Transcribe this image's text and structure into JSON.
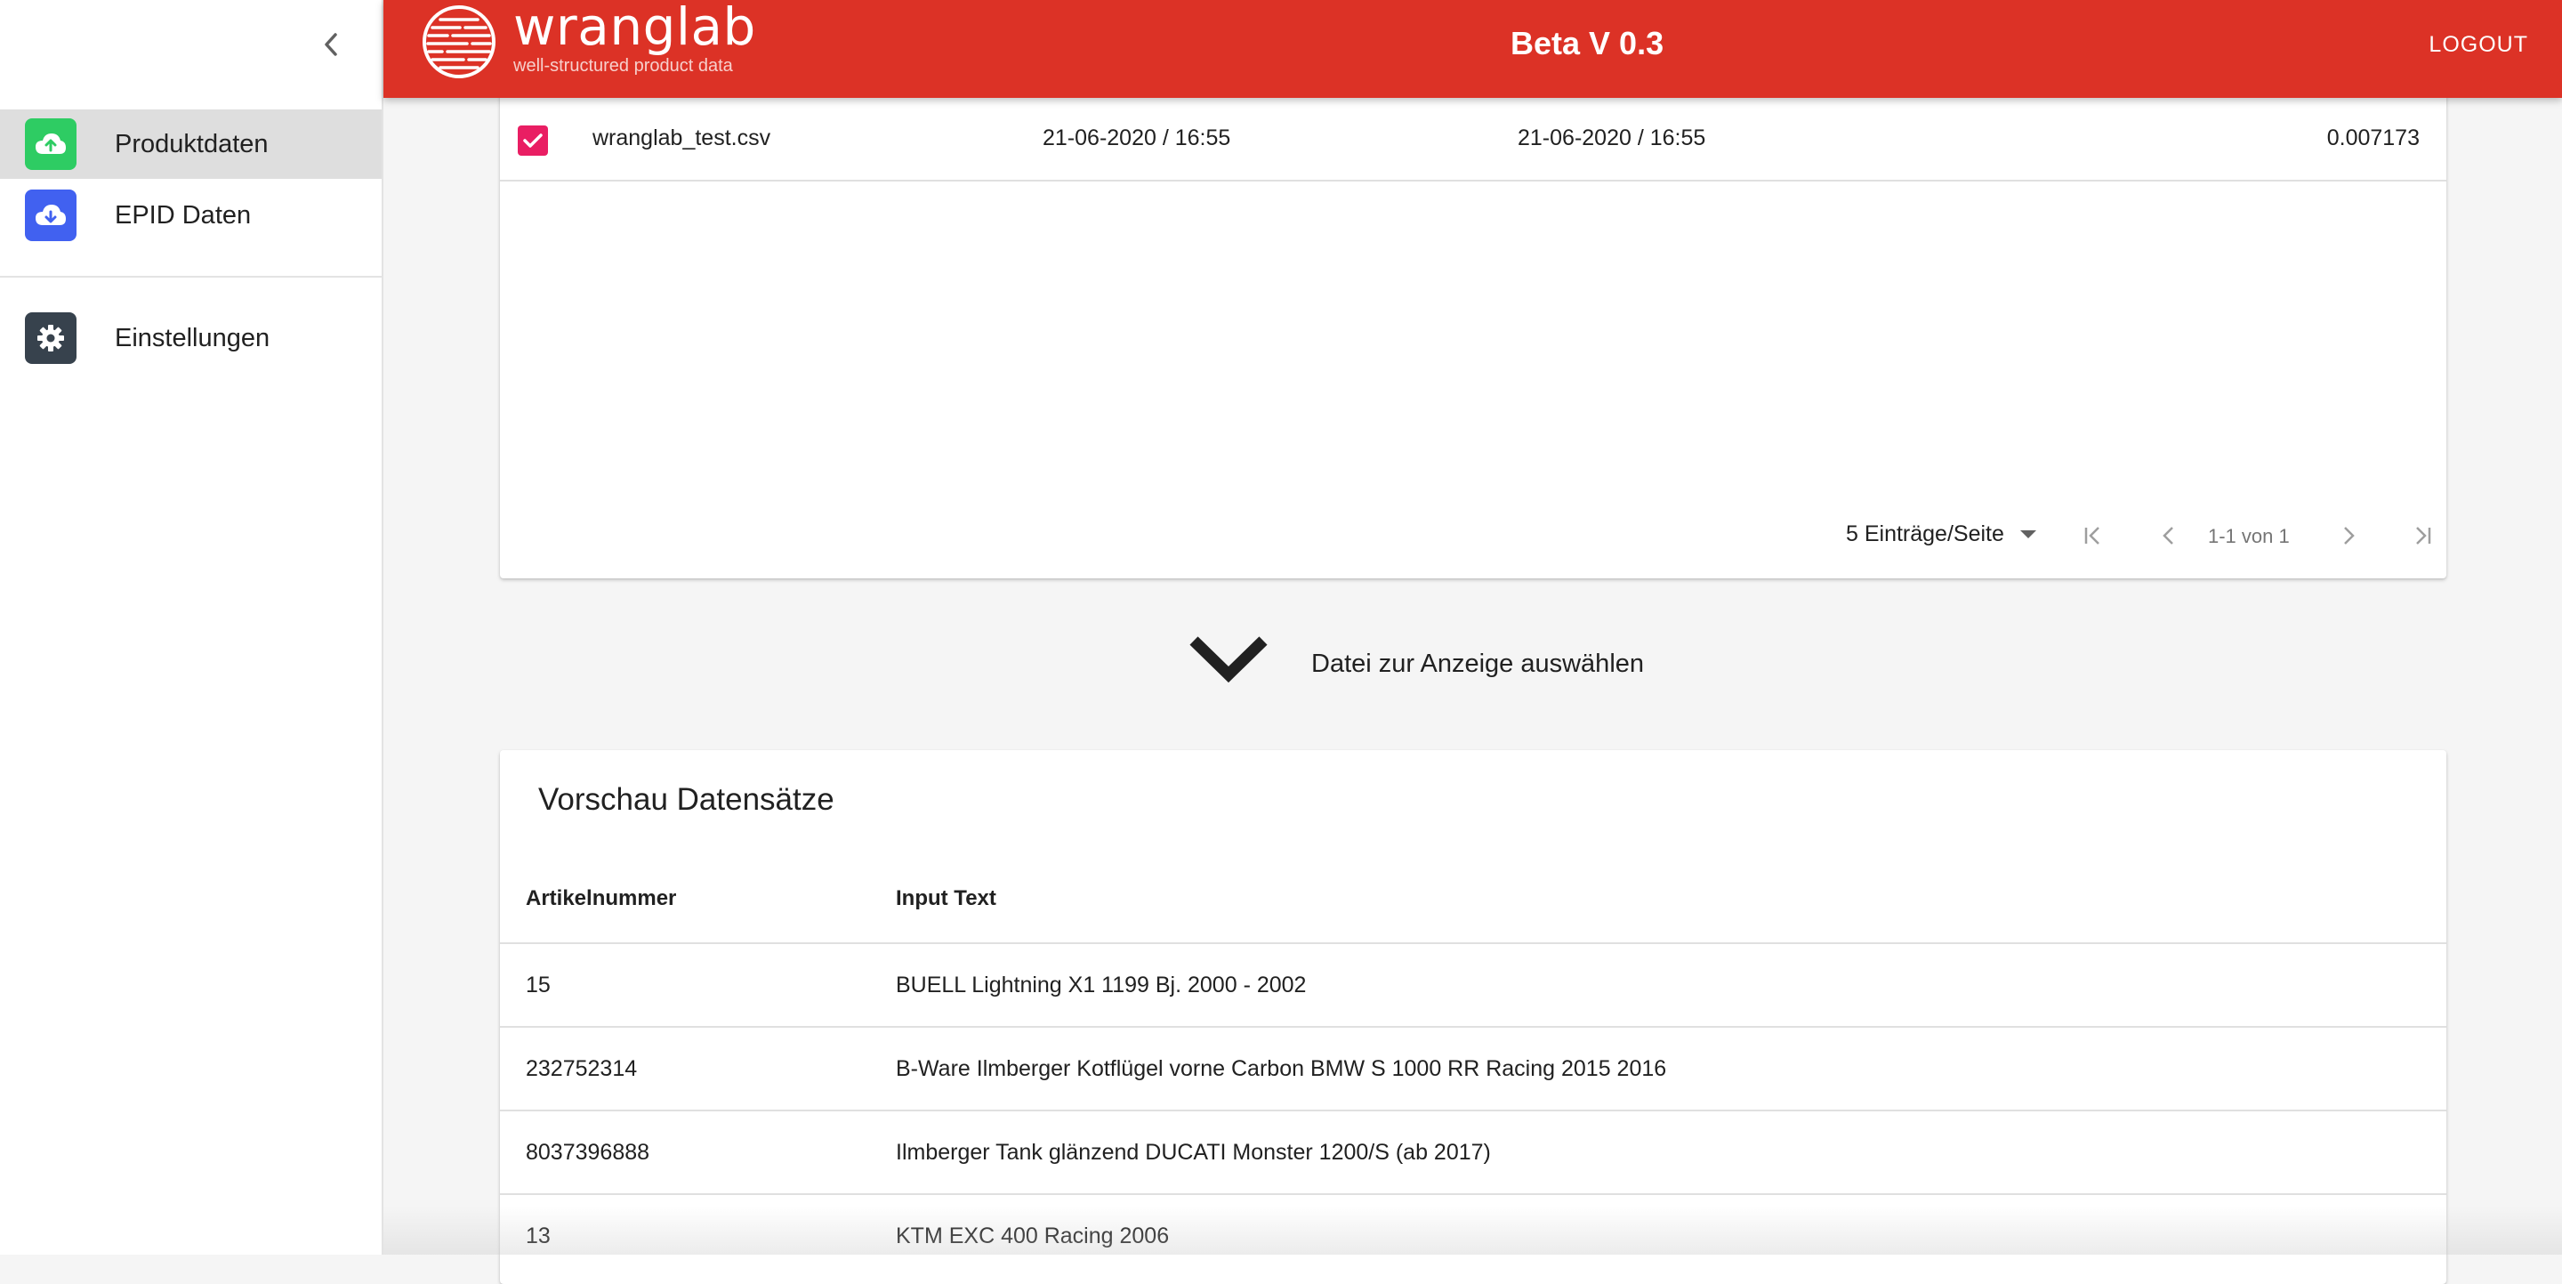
{
  "sidebar": {
    "collapse_icon": "chevron-left-icon",
    "items": [
      {
        "label": "Produktdaten",
        "icon": "cloud-upload-icon",
        "color": "#2ecc63",
        "active": true
      },
      {
        "label": "EPID Daten",
        "icon": "cloud-download-icon",
        "color": "#4161f0",
        "active": false
      },
      {
        "label": "Einstellungen",
        "icon": "gear-icon",
        "color": "#37424d",
        "active": false
      }
    ]
  },
  "header": {
    "brand_name": "wranglab",
    "brand_tagline": "well-structured product data",
    "version": "Beta V 0.3",
    "logout_label": "LOGOUT",
    "color": "#dc3226"
  },
  "files": {
    "rows": [
      {
        "checked": true,
        "name": "wranglab_test.csv",
        "created": "21-06-2020 / 16:55",
        "modified": "21-06-2020 / 16:55",
        "size": "0.007173"
      }
    ],
    "pagination": {
      "per_page_label": "5 Einträge/Seite",
      "range": "1-1 von 1"
    },
    "checkbox_color": "#e91e63"
  },
  "select_hint": {
    "icon": "chevron-down-icon",
    "text": "Datei zur Anzeige auswählen"
  },
  "preview": {
    "title": "Vorschau Datensätze",
    "columns": [
      "Artikelnummer",
      "Input Text"
    ],
    "rows": [
      [
        "15",
        "BUELL Lightning X1 1199 Bj. 2000 - 2002"
      ],
      [
        "232752314",
        "B-Ware Ilmberger Kotflügel vorne Carbon BMW S 1000 RR Racing 2015 2016"
      ],
      [
        "8037396888",
        "Ilmberger Tank glänzend DUCATI Monster 1200/S (ab 2017)"
      ],
      [
        "13",
        "KTM EXC 400 Racing 2006"
      ]
    ]
  }
}
